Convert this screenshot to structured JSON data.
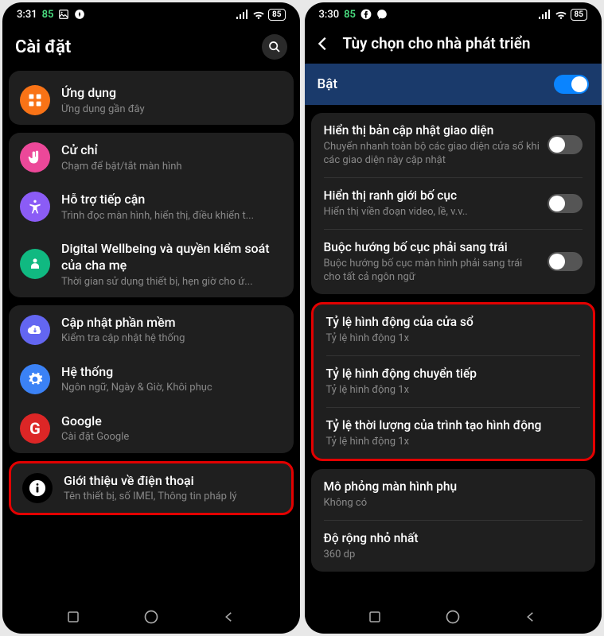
{
  "left": {
    "statusBar": {
      "time": "3:31",
      "greenNum": "85",
      "batteryPct": "85"
    },
    "header": {
      "title": "Cài đặt"
    },
    "groups": [
      {
        "items": [
          {
            "iconColor": "#f97316",
            "iconName": "grid-icon",
            "title": "Ứng dụng",
            "sub": "Ứng dụng gần đây"
          }
        ],
        "cutTop": true
      },
      {
        "items": [
          {
            "iconColor": "#ec4899",
            "iconName": "hand-icon",
            "title": "Cử chỉ",
            "sub": "Chạm để bật/tắt màn hình"
          },
          {
            "iconColor": "#8b5cf6",
            "iconName": "accessibility-icon",
            "title": "Hỗ trợ tiếp cận",
            "sub": "Trình đọc màn hình, hiển thị, điều khiển t..."
          },
          {
            "iconColor": "#10b981",
            "iconName": "wellbeing-icon",
            "title": "Digital Wellbeing và quyền kiểm soát của cha mẹ",
            "sub": "Thời gian sử dụng thiết bị, hẹn giờ cho ứ..."
          }
        ]
      },
      {
        "items": [
          {
            "iconColor": "#6366f1",
            "iconName": "cloud-icon",
            "title": "Cập nhật phần mềm",
            "sub": "Kiểm tra cập nhật hệ thống"
          },
          {
            "iconColor": "#3b82f6",
            "iconName": "gear-icon",
            "title": "Hệ thống",
            "sub": "Ngôn ngữ, Ngày & Giờ, Khôi phục"
          },
          {
            "iconColor": "#dc2626",
            "iconName": "google-icon",
            "title": "Google",
            "sub": "Cài đặt Google"
          }
        ]
      },
      {
        "highlight": true,
        "items": [
          {
            "iconColor": "#000",
            "iconFg": "#fff",
            "iconBg": "#fff",
            "iconName": "info-icon",
            "title": "Giới thiệu về điện thoại",
            "sub": "Tên thiết bị, số IMEI, Thông tin pháp lý"
          }
        ]
      }
    ]
  },
  "right": {
    "statusBar": {
      "time": "3:30",
      "greenNum": "85",
      "batteryPct": "85"
    },
    "header": {
      "title": "Tùy chọn cho nhà phát triển"
    },
    "enable": {
      "label": "Bật",
      "on": true
    },
    "sections": [
      {
        "items": [
          {
            "title": "Hiển thị bản cập nhật giao diện",
            "sub": "Chuyển nhanh toàn bộ các giao diện cửa sổ khi các giao diện này cập nhật",
            "toggle": false
          },
          {
            "title": "Hiển thị ranh giới bố cục",
            "sub": "Hiển thị viền đoạn video, lề, v.v..",
            "toggle": false
          },
          {
            "title": "Buộc hướng bố cục phải sang trái",
            "sub": "Buộc hướng bố cục màn hình phải sang trái cho tất cả ngôn ngữ",
            "toggle": false
          }
        ]
      },
      {
        "highlight": true,
        "items": [
          {
            "title": "Tỷ lệ hình động của cửa sổ",
            "sub": "Tỷ lệ hình động 1x"
          },
          {
            "title": "Tỷ lệ hình động chuyển tiếp",
            "sub": "Tỷ lệ hình động 1x"
          },
          {
            "title": "Tỷ lệ thời lượng của trình tạo hình động",
            "sub": "Tỷ lệ hình động 1x"
          }
        ]
      },
      {
        "items": [
          {
            "title": "Mô phỏng màn hình phụ",
            "sub": "Không có"
          },
          {
            "title": "Độ rộng nhỏ nhất",
            "sub": "360 dp"
          }
        ]
      }
    ]
  }
}
